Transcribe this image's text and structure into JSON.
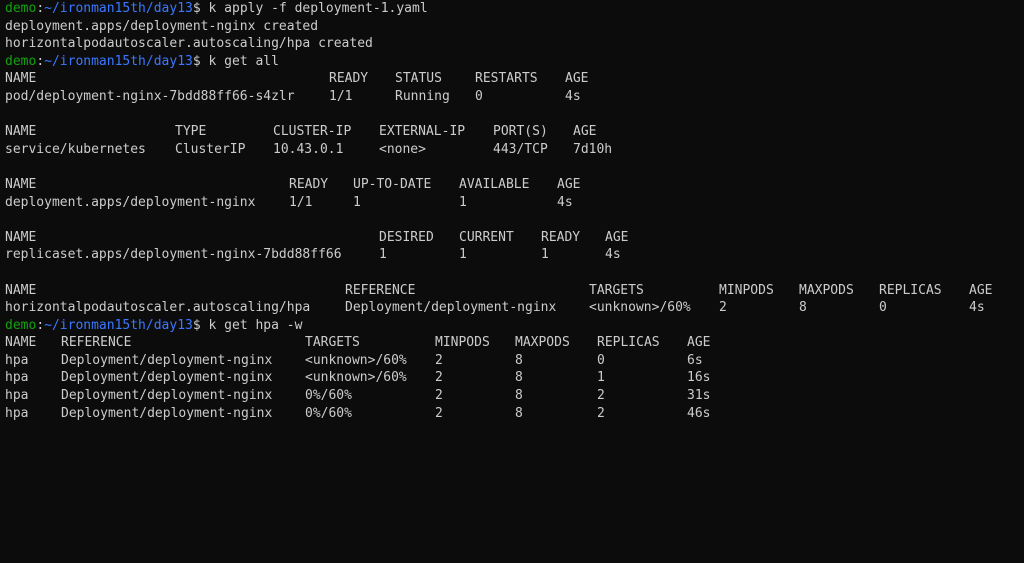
{
  "colors": {
    "background": "#0c0c0c",
    "text": "#cccccc",
    "prompt_user": "#13a10e",
    "prompt_path": "#3b78ff"
  },
  "prompts": [
    {
      "user": "demo",
      "path": "~/ironman15th/day13",
      "command": "k apply -f deployment-1.yaml"
    },
    {
      "user": "demo",
      "path": "~/ironman15th/day13",
      "command": "k get all"
    },
    {
      "user": "demo",
      "path": "~/ironman15th/day13",
      "command": "k get hpa -w"
    }
  ],
  "apply_output": [
    "deployment.apps/deployment-nginx created",
    "horizontalpodautoscaler.autoscaling/hpa created"
  ],
  "get_all": {
    "pods": {
      "headers": [
        "NAME",
        "READY",
        "STATUS",
        "RESTARTS",
        "AGE"
      ],
      "rows": [
        [
          "pod/deployment-nginx-7bdd88ff66-s4zlr",
          "1/1",
          "Running",
          "0",
          "4s"
        ]
      ]
    },
    "services": {
      "headers": [
        "NAME",
        "TYPE",
        "CLUSTER-IP",
        "EXTERNAL-IP",
        "PORT(S)",
        "AGE"
      ],
      "rows": [
        [
          "service/kubernetes",
          "ClusterIP",
          "10.43.0.1",
          "<none>",
          "443/TCP",
          "7d10h"
        ]
      ]
    },
    "deployments": {
      "headers": [
        "NAME",
        "READY",
        "UP-TO-DATE",
        "AVAILABLE",
        "AGE"
      ],
      "rows": [
        [
          "deployment.apps/deployment-nginx",
          "1/1",
          "1",
          "1",
          "4s"
        ]
      ]
    },
    "replicasets": {
      "headers": [
        "NAME",
        "DESIRED",
        "CURRENT",
        "READY",
        "AGE"
      ],
      "rows": [
        [
          "replicaset.apps/deployment-nginx-7bdd88ff66",
          "1",
          "1",
          "1",
          "4s"
        ]
      ]
    },
    "hpas": {
      "headers": [
        "NAME",
        "REFERENCE",
        "TARGETS",
        "MINPODS",
        "MAXPODS",
        "REPLICAS",
        "AGE"
      ],
      "rows": [
        [
          "horizontalpodautoscaler.autoscaling/hpa",
          "Deployment/deployment-nginx",
          "<unknown>/60%",
          "2",
          "8",
          "0",
          "4s"
        ]
      ]
    }
  },
  "hpa_watch": {
    "headers": [
      "NAME",
      "REFERENCE",
      "TARGETS",
      "MINPODS",
      "MAXPODS",
      "REPLICAS",
      "AGE"
    ],
    "rows": [
      [
        "hpa",
        "Deployment/deployment-nginx",
        "<unknown>/60%",
        "2",
        "8",
        "0",
        "6s"
      ],
      [
        "hpa",
        "Deployment/deployment-nginx",
        "<unknown>/60%",
        "2",
        "8",
        "1",
        "16s"
      ],
      [
        "hpa",
        "Deployment/deployment-nginx",
        "0%/60%",
        "2",
        "8",
        "2",
        "31s"
      ],
      [
        "hpa",
        "Deployment/deployment-nginx",
        "0%/60%",
        "2",
        "8",
        "2",
        "46s"
      ]
    ]
  }
}
